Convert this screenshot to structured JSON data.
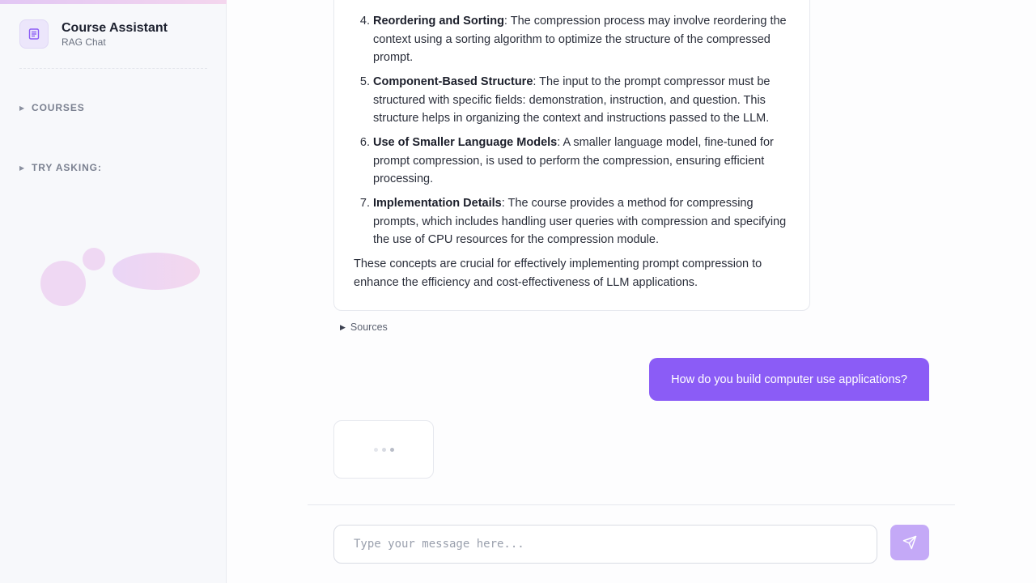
{
  "brand": {
    "title": "Course Assistant",
    "subtitle": "RAG Chat",
    "icon": "document-icon"
  },
  "sidebar": {
    "sections": [
      {
        "label": "COURSES",
        "expanded": false
      },
      {
        "label": "TRY ASKING:",
        "expanded": false
      }
    ]
  },
  "conversation": {
    "assistant_answer": {
      "list_start": 4,
      "items": [
        {
          "title": "Reordering and Sorting",
          "text": ": The compression process may involve reordering the context using a sorting algorithm to optimize the structure of the compressed prompt."
        },
        {
          "title": "Component-Based Structure",
          "text": ": The input to the prompt compressor must be structured with specific fields: demonstration, instruction, and question. This structure helps in organizing the context and instructions passed to the LLM."
        },
        {
          "title": "Use of Smaller Language Models",
          "text": ": A smaller language model, fine-tuned for prompt compression, is used to perform the compression, ensuring efficient processing."
        },
        {
          "title": "Implementation Details",
          "text": ": The course provides a method for compressing prompts, which includes handling user queries with compression and specifying the use of CPU resources for the compression module."
        }
      ],
      "conclusion": "These concepts are crucial for effectively implementing prompt compression to enhance the efficiency and cost-effectiveness of LLM applications."
    },
    "sources_label": "Sources",
    "user_message": "How do you build computer use applications?",
    "loading": true
  },
  "composer": {
    "placeholder": "Type your message here...",
    "value": "",
    "send_icon": "send-icon"
  },
  "colors": {
    "accent": "#8b5cf6",
    "accent_disabled": "#c4a9f7",
    "sidebar_bg": "#f7f8fb"
  }
}
